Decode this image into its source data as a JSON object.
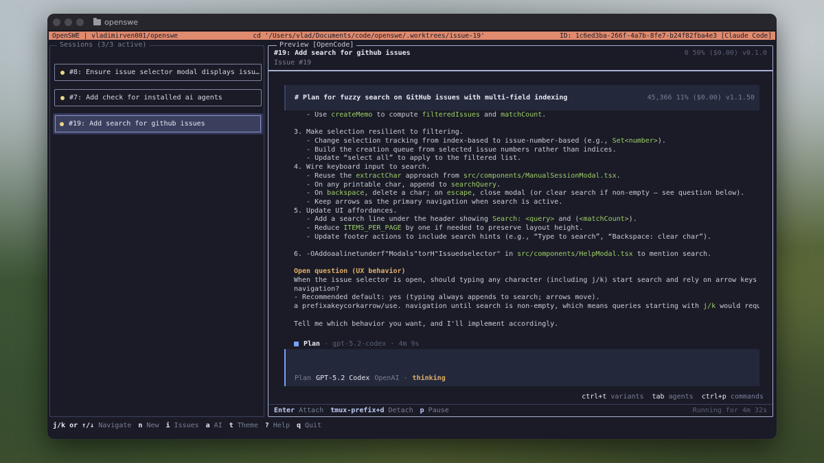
{
  "window": {
    "title": "openswe"
  },
  "statusbar": {
    "left": "OpenSWE | vladimirven001/openswe",
    "middle": "cd '/Users/vlad/Documents/code/openswe/.worktrees/issue-19'",
    "right": "ID: 1c6ed3ba-266f-4a7b-8fe7-b24f82fba4e3 [Claude Code]"
  },
  "sessions": {
    "legend": "Sessions (3/3 active)",
    "items": [
      {
        "label": "#8: Ensure issue selector modal displays issu…"
      },
      {
        "label": "#7: Add check for installed ai agents"
      },
      {
        "label": "#19: Add search for github issues"
      }
    ]
  },
  "preview": {
    "legend": "Preview [OpenCode]",
    "title": "#19: Add search for github issues",
    "subtitle": "Issue #19",
    "stats": "0  50% ($0.00) v0.1.0",
    "plan_title": "# Plan for fuzzy search on GitHub issues with multi-field indexing",
    "plan_stats": "45,366  11% ($0.00) v1.1.50",
    "lines": [
      [
        "   - Use ",
        {
          "hl": "createMemo"
        },
        " to compute ",
        {
          "hl": "filteredIssues"
        },
        " and ",
        {
          "hl": "matchCount"
        },
        "."
      ],
      [
        ""
      ],
      [
        "3. Make selection resilient to filtering."
      ],
      [
        "   - Change selection tracking from index-based to issue-number-based (e.g., ",
        {
          "hl": "Set<number>"
        },
        ")."
      ],
      [
        "   - Build the creation queue from selected issue numbers rather than indices."
      ],
      [
        "   - Update “select all” to apply to the filtered list."
      ],
      [
        "4. Wire keyboard input to search."
      ],
      [
        "   - Reuse the ",
        {
          "hl": "extractChar"
        },
        " approach from ",
        {
          "hl": "src/components/ManualSessionModal.tsx"
        },
        "."
      ],
      [
        "   - On any printable char, append to ",
        {
          "hl": "searchQuery"
        },
        "."
      ],
      [
        "   - On ",
        {
          "hl": "backspace"
        },
        ", delete a char; on ",
        {
          "hl": "escape"
        },
        ", close modal (or clear search if non-empty — see question below)."
      ],
      [
        "   - Keep arrows as the primary navigation when search is active."
      ],
      [
        "5. Update UI affordances."
      ],
      [
        "   - Add a search line under the header showing ",
        {
          "hl": "Search: <query>"
        },
        " and (",
        {
          "hl": "<matchCount>"
        },
        ")."
      ],
      [
        "   - Reduce ",
        {
          "hl": "ITEMS_PER_PAGE"
        },
        " by one if needed to preserve layout height."
      ],
      [
        "   - Update footer actions to include search hints (e.g., “Type to search”, “Backspace: clear char”)."
      ],
      [
        ""
      ],
      [
        "6. -OAddoaalinetunderf\"Modals\"torH\"Issuedselector\" in ",
        {
          "hl": "src/components/HelpModal.tsx"
        },
        " to mention search."
      ],
      [
        ""
      ],
      [
        {
          "hl2": "Open question (UX behavior)"
        }
      ],
      [
        "When the issue selector is open, should typing any character (including j/k) start search and rely on arrow keys for"
      ],
      [
        "navigation?"
      ],
      [
        "- Recommended default: yes (typing always appends to search; arrows move)."
      ],
      [
        "a prefixakeycorkarrow/use. navigation until search is non-empty, which means queries starting with ",
        {
          "hl": "j/k"
        },
        " would require"
      ],
      [
        ""
      ],
      [
        "Tell me which behavior you want, and I'll implement accordingly."
      ]
    ],
    "plan_label": "Plan",
    "plan_meta": "· gpt-5.2-codex · 4m 9s",
    "input_status": {
      "mode": "Plan",
      "model": "GPT-5.2 Codex",
      "provider": "OpenAI ·",
      "state": "thinking"
    },
    "shortcuts": [
      {
        "key": "ctrl+t",
        "label": "variants"
      },
      {
        "key": "tab",
        "label": "agents"
      },
      {
        "key": "ctrl+p",
        "label": "commands"
      }
    ],
    "footer": [
      {
        "key": "Enter",
        "label": "Attach"
      },
      {
        "key": "tmux-prefix+d",
        "label": "Detach"
      },
      {
        "key": "p",
        "label": "Pause"
      }
    ],
    "running": "Running for 4m 32s"
  },
  "bottombar": [
    {
      "key": "j/k or ↑/↓",
      "label": "Navigate"
    },
    {
      "key": "n",
      "label": "New"
    },
    {
      "key": "i",
      "label": "Issues"
    },
    {
      "key": "a",
      "label": "AI"
    },
    {
      "key": "t",
      "label": "Theme"
    },
    {
      "key": "?",
      "label": "Help"
    },
    {
      "key": "q",
      "label": "Quit"
    }
  ],
  "colors": {
    "accent": "#e08a6e",
    "highlight": "#9ece6a",
    "warning": "#e0af68",
    "background": "#1a1b26"
  }
}
